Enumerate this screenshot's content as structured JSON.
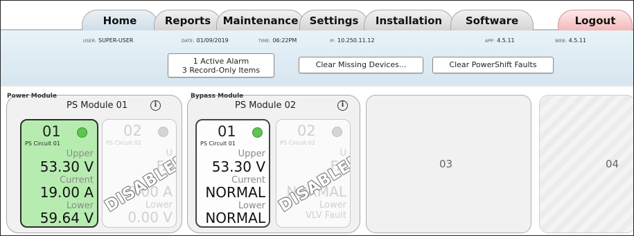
{
  "tabs": [
    {
      "label": "Home"
    },
    {
      "label": "Reports"
    },
    {
      "label": "Maintenance"
    },
    {
      "label": "Settings"
    },
    {
      "label": "Installation"
    },
    {
      "label": "Software"
    },
    {
      "label": "Logout"
    }
  ],
  "header": {
    "user_label": "USER:",
    "user_value": "SUPER-USER",
    "date_label": "DATE:",
    "date_value": "01/09/2019",
    "time_label": "TIME:",
    "time_value": "06:22PM",
    "ip_label": "IP:",
    "ip_value": "10.250.11.12",
    "app_label": "APP:",
    "app_value": "4.5.11",
    "web_label": "WEB:",
    "web_value": "4.5.11",
    "alarm_line1": "1 Active Alarm",
    "alarm_line2": "3 Record-Only Items",
    "clear_missing": "Clear Missing Devices...",
    "clear_powershift": "Clear PowerShift Faults"
  },
  "modules": [
    {
      "category": "Power Module",
      "title": "PS Module 01",
      "circuits": [
        {
          "num": "01",
          "circuit": "PS Circuit 01",
          "upper_label": "Upper",
          "upper_value": "53.30 V",
          "current_label": "Current",
          "current_value": "19.00 A",
          "lower_label": "Lower",
          "lower_value": "59.64 V"
        },
        {
          "num": "02",
          "circuit": "PS Circuit 02",
          "upper_label": "U",
          "upper_value": "FA",
          "current_label": "",
          "current_value": "0.00 A",
          "lower_label": "Lower",
          "lower_value": "0.00 V",
          "stamp": "DISABLED"
        }
      ]
    },
    {
      "category": "Bypass Module",
      "title": "PS Module 02",
      "circuits": [
        {
          "num": "01",
          "circuit": "PS Circuit 01",
          "upper_label": "Upper",
          "upper_value": "53.30 V",
          "current_label": "Current",
          "current_value": "NORMAL",
          "lower_label": "Lower",
          "lower_value": "NORMAL"
        },
        {
          "num": "02",
          "circuit": "PS Circuit 02",
          "upper_label": "U",
          "upper_value": "FA",
          "current_label": "",
          "current_value": "NORMAL",
          "lower_label": "Lower",
          "lower_value": "VLV Fault",
          "stamp": "DISABLED"
        }
      ]
    }
  ],
  "slots": [
    {
      "label": "03"
    },
    {
      "label": "04"
    }
  ],
  "colors": {
    "active_green": "#b7ecb1",
    "status_dot": "#5cc64e",
    "header_bg": "#e8f2f8",
    "logout_tab": "#f2b9b9"
  }
}
